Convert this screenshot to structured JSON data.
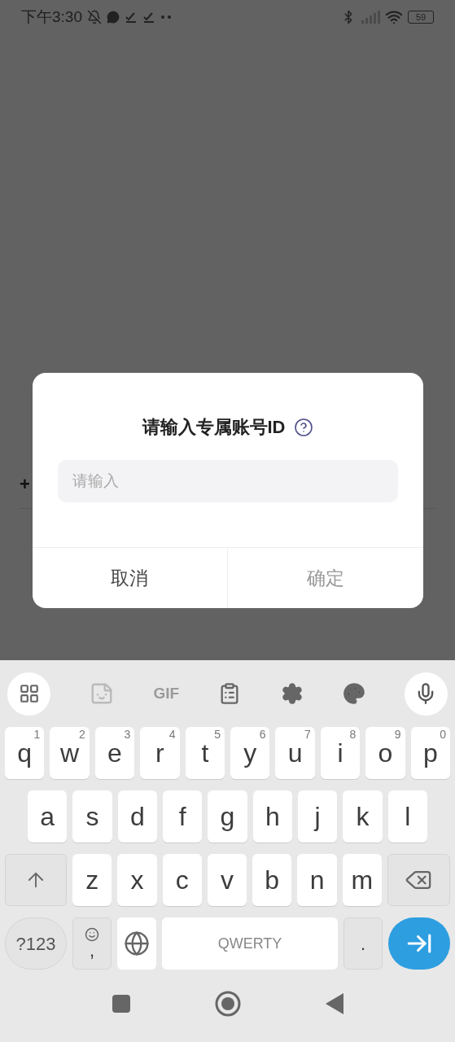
{
  "status_bar": {
    "time": "下午3:30",
    "battery": "59"
  },
  "background": {
    "plus": "+"
  },
  "dialog": {
    "title": "请输入专属账号ID",
    "input": {
      "placeholder": "请输入"
    },
    "buttons": [
      {
        "label": "取消",
        "disabled": false
      },
      {
        "label": "确定",
        "disabled": true
      }
    ]
  },
  "keyboard": {
    "toolbar": {
      "gif": "GIF"
    },
    "rows": [
      [
        {
          "kind": "letter",
          "key": "q",
          "hint": "1"
        },
        {
          "kind": "letter",
          "key": "w",
          "hint": "2"
        },
        {
          "kind": "letter",
          "key": "e",
          "hint": "3"
        },
        {
          "kind": "letter",
          "key": "r",
          "hint": "4"
        },
        {
          "kind": "letter",
          "key": "t",
          "hint": "5"
        },
        {
          "kind": "letter",
          "key": "y",
          "hint": "6"
        },
        {
          "kind": "letter",
          "key": "u",
          "hint": "7"
        },
        {
          "kind": "letter",
          "key": "i",
          "hint": "8"
        },
        {
          "kind": "letter",
          "key": "o",
          "hint": "9"
        },
        {
          "kind": "letter",
          "key": "p",
          "hint": "0"
        }
      ],
      [
        {
          "kind": "letter",
          "key": "a"
        },
        {
          "kind": "letter",
          "key": "s"
        },
        {
          "kind": "letter",
          "key": "d"
        },
        {
          "kind": "letter",
          "key": "f"
        },
        {
          "kind": "letter",
          "key": "g"
        },
        {
          "kind": "letter",
          "key": "h"
        },
        {
          "kind": "letter",
          "key": "j"
        },
        {
          "kind": "letter",
          "key": "k"
        },
        {
          "kind": "letter",
          "key": "l"
        }
      ],
      [
        {
          "kind": "shift"
        },
        {
          "kind": "letter",
          "key": "z"
        },
        {
          "kind": "letter",
          "key": "x"
        },
        {
          "kind": "letter",
          "key": "c"
        },
        {
          "kind": "letter",
          "key": "v"
        },
        {
          "kind": "letter",
          "key": "b"
        },
        {
          "kind": "letter",
          "key": "n"
        },
        {
          "kind": "letter",
          "key": "m"
        },
        {
          "kind": "backspace"
        }
      ]
    ],
    "bottom_row": [
      {
        "kind": "symbols",
        "key": "?123"
      },
      {
        "kind": "comma",
        "key": ","
      },
      {
        "kind": "globe"
      },
      {
        "kind": "space",
        "key": "QWERTY"
      },
      {
        "kind": "period",
        "key": "."
      },
      {
        "kind": "enter"
      }
    ]
  }
}
